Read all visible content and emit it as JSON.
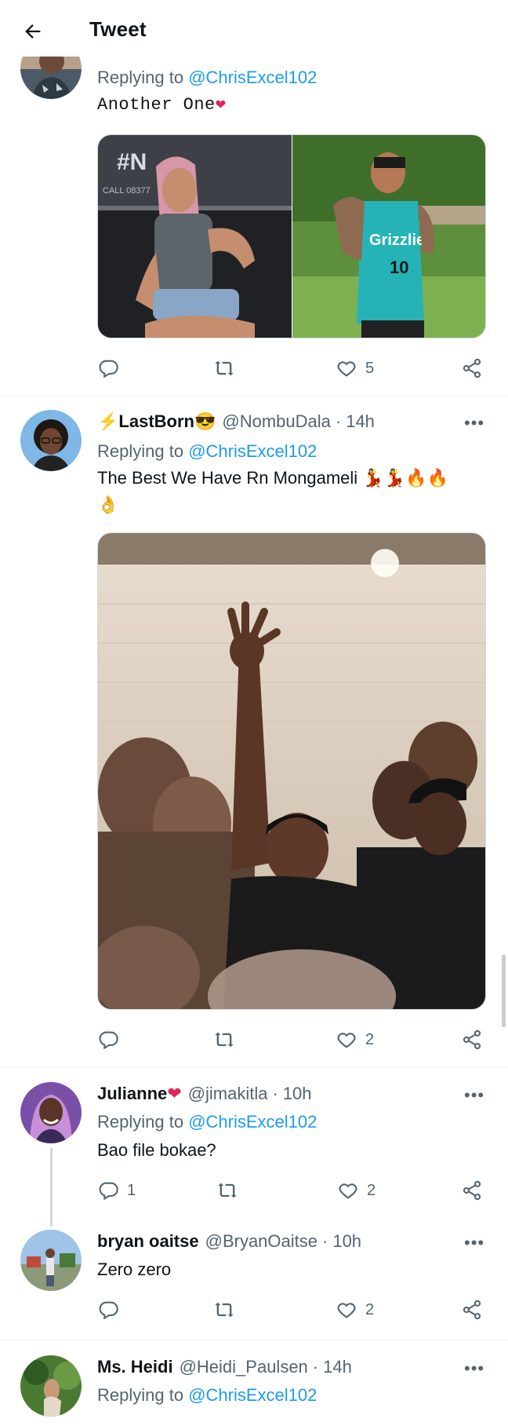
{
  "header": {
    "title": "Tweet",
    "back_icon": "arrow-left-icon"
  },
  "colors": {
    "link": "#1d9bf0",
    "muted": "#536471",
    "text": "#0f1419",
    "heart": "#f91880"
  },
  "tweets": [
    {
      "reply_prefix": "Replying to",
      "reply_to": "@ChrisExcel102",
      "text": "Another One",
      "emoji": "❤",
      "likes": "5"
    },
    {
      "name": "LastBorn",
      "name_emoji": "😎",
      "handle": "@NombuDala",
      "time": "14h",
      "reply_prefix": "Replying to",
      "reply_to": "@ChrisExcel102",
      "text": "The Best We Have Rn Mongameli",
      "text_emoji": "💃💃🔥🔥",
      "text_emoji_line2": "👌",
      "likes": "2"
    },
    {
      "name": "Julianne",
      "name_emoji": "❤",
      "handle": "@jimakitla",
      "time": "10h",
      "reply_prefix": "Replying to",
      "reply_to": "@ChrisExcel102",
      "text": "Bao file bokae?",
      "replies": "1",
      "likes": "2"
    },
    {
      "name": "bryan oaitse",
      "handle": "@BryanOaitse",
      "time": "10h",
      "text": "Zero zero",
      "likes": "2"
    },
    {
      "name": "Ms. Heidi",
      "handle": "@Heidi_Paulsen",
      "time": "14h",
      "reply_prefix": "Replying to",
      "reply_to": "@ChrisExcel102"
    }
  ],
  "more_label": "•••",
  "time_sep": "·"
}
